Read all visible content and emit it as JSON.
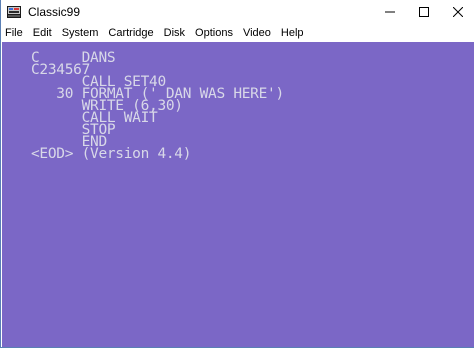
{
  "window": {
    "title": "Classic99",
    "icon": "classic99-app-icon",
    "controls": [
      "minimize-icon",
      "maximize-icon",
      "close-icon"
    ]
  },
  "menu": {
    "items": [
      "File",
      "Edit",
      "System",
      "Cartridge",
      "Disk",
      "Options",
      "Video",
      "Help"
    ]
  },
  "screen": {
    "background": "#7b67c6",
    "text_color": "#d8d8e8",
    "lines": [
      "C     DANS",
      "C234567",
      "      CALL SET40",
      "   30 FORMAT (' DAN WAS HERE')",
      "      WRITE (6,30)",
      "      CALL WAIT",
      "      STOP",
      "      END",
      "<EOD> (Version 4.4)"
    ]
  }
}
